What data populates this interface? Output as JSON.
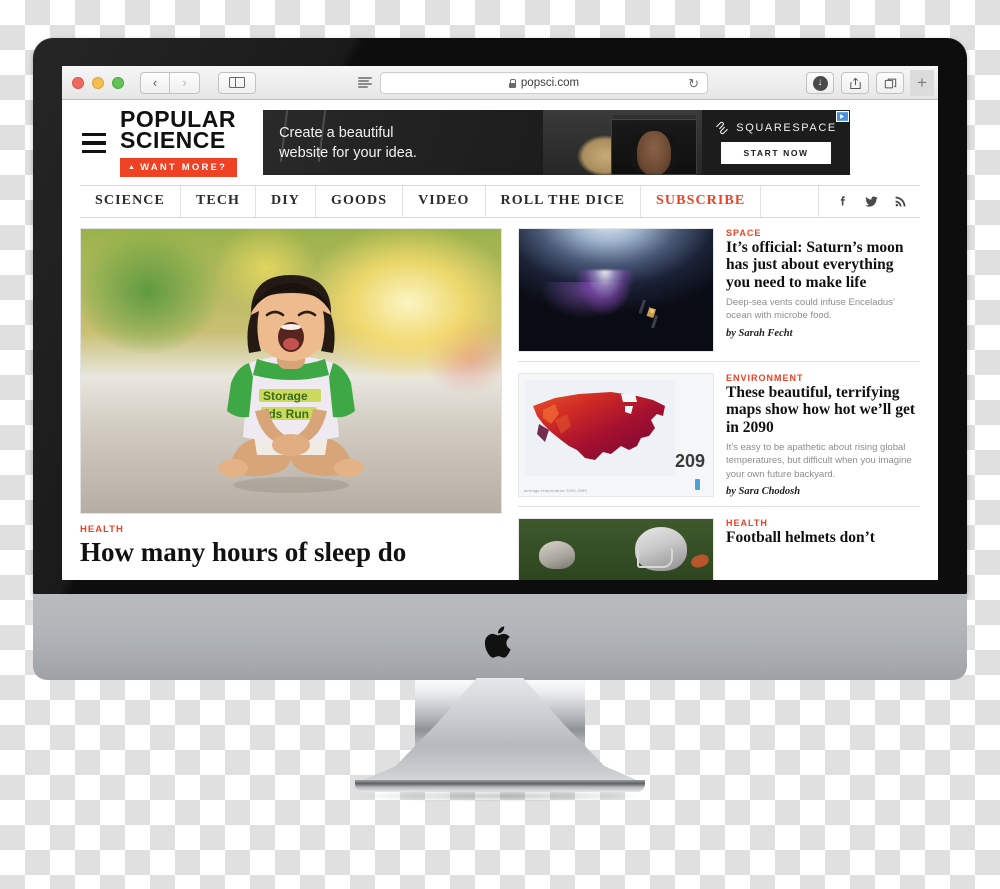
{
  "browser": {
    "url": "popsci.com",
    "back_label": "‹",
    "forward_label": "›",
    "reload_label": "↻",
    "new_tab_label": "+",
    "download_label": "↓",
    "traffic_lights": [
      "close",
      "minimize",
      "zoom"
    ]
  },
  "site": {
    "brand_line1": "POPULAR",
    "brand_line2": "SCIENCE",
    "want_more_label": "WANT MORE?",
    "want_more_triangle": "▲"
  },
  "ad": {
    "headline_line1": "Create a beautiful",
    "headline_line2": "website for your idea.",
    "brand": "SQUARESPACE",
    "cta": "START NOW",
    "adchoices": "AdChoices"
  },
  "nav": {
    "items": [
      {
        "label": "SCIENCE",
        "accent": false
      },
      {
        "label": "TECH",
        "accent": false
      },
      {
        "label": "DIY",
        "accent": false
      },
      {
        "label": "GOODS",
        "accent": false
      },
      {
        "label": "VIDEO",
        "accent": false
      },
      {
        "label": "ROLL THE DICE",
        "accent": false
      },
      {
        "label": "SUBSCRIBE",
        "accent": true
      }
    ],
    "social": [
      "facebook-icon",
      "twitter-icon",
      "rss-icon"
    ],
    "accent_color": "#ef4124"
  },
  "featured": {
    "category": "HEALTH",
    "headline": "How many hours of sleep do"
  },
  "cards": [
    {
      "category": "SPACE",
      "title": "It’s official: Saturn’s moon has just about everything you need to make life",
      "dek": "Deep-sea vents could infuse Enceladus’ ocean with microbe food.",
      "byline": "by Sarah Fecht",
      "thumb": "enceladus-plume-image"
    },
    {
      "category": "ENVIRONMENT",
      "title": "These beautiful, terrifying maps show how hot we’ll get in 2090",
      "dek": "It’s easy to be apathetic about rising global temperatures, but difficult when you imagine your own future backyard.",
      "byline": "by Sara Chodosh",
      "thumb": "us-heat-map-image",
      "map_number": "209",
      "map_credit": "average temperature 2090 2099"
    },
    {
      "category": "HEALTH",
      "title": "Football helmets don’t",
      "dek": "",
      "byline": "",
      "thumb": "football-players-image"
    }
  ],
  "device": {
    "name": "imac",
    "logo": "apple-logo"
  }
}
